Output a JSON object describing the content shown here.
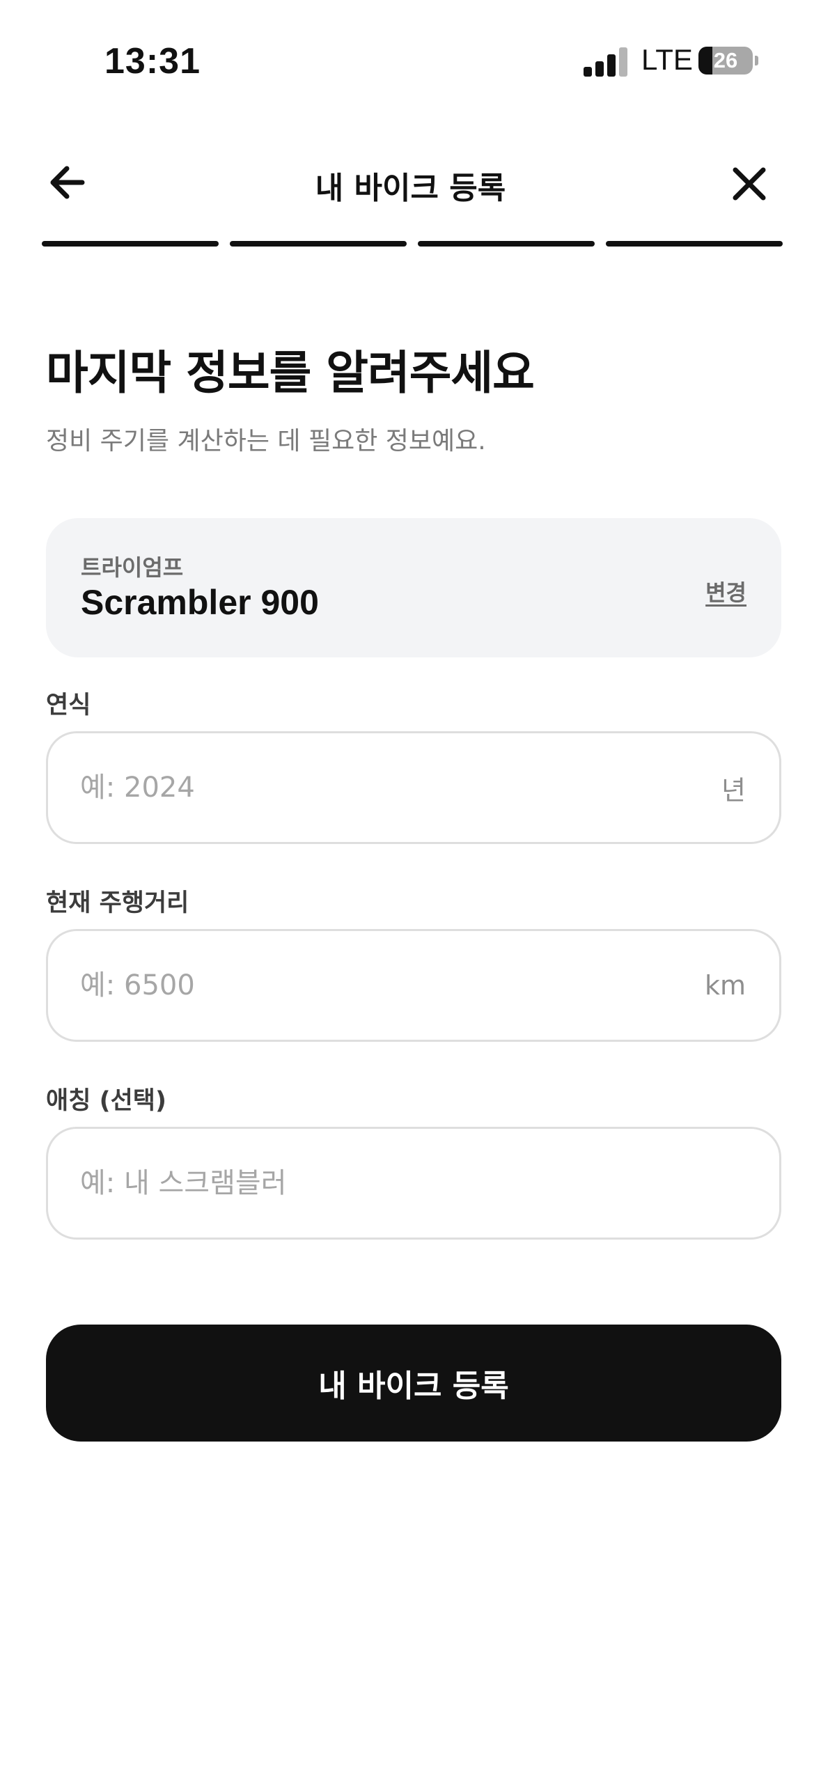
{
  "status_bar": {
    "time": "13:31",
    "network": "LTE",
    "battery_level": "26",
    "battery_percent": 26
  },
  "header": {
    "title": "내 바이크 등록",
    "back_icon": "arrow-left-icon",
    "close_icon": "close-icon"
  },
  "progress": {
    "total_steps": 4,
    "completed_steps": 4
  },
  "main": {
    "title": "마지막 정보를 알려주세요",
    "subtitle": "정비 주기를 계산하는 데 필요한 정보예요."
  },
  "bike": {
    "brand": "트라이엄프",
    "model": "Scrambler 900",
    "change_label": "변경"
  },
  "form": {
    "year": {
      "label": "연식",
      "placeholder": "예: 2024",
      "unit": "년",
      "value": ""
    },
    "mileage": {
      "label": "현재 주행거리",
      "placeholder": "예: 6500",
      "unit": "km",
      "value": ""
    },
    "nickname": {
      "label": "애칭 (선택)",
      "placeholder": "예: 내 스크램블러",
      "value": ""
    }
  },
  "submit_label": "내 바이크 등록",
  "colors": {
    "primary": "#111111",
    "card_bg": "#f3f4f6",
    "placeholder": "#a6a6a6",
    "border": "#dedede"
  }
}
